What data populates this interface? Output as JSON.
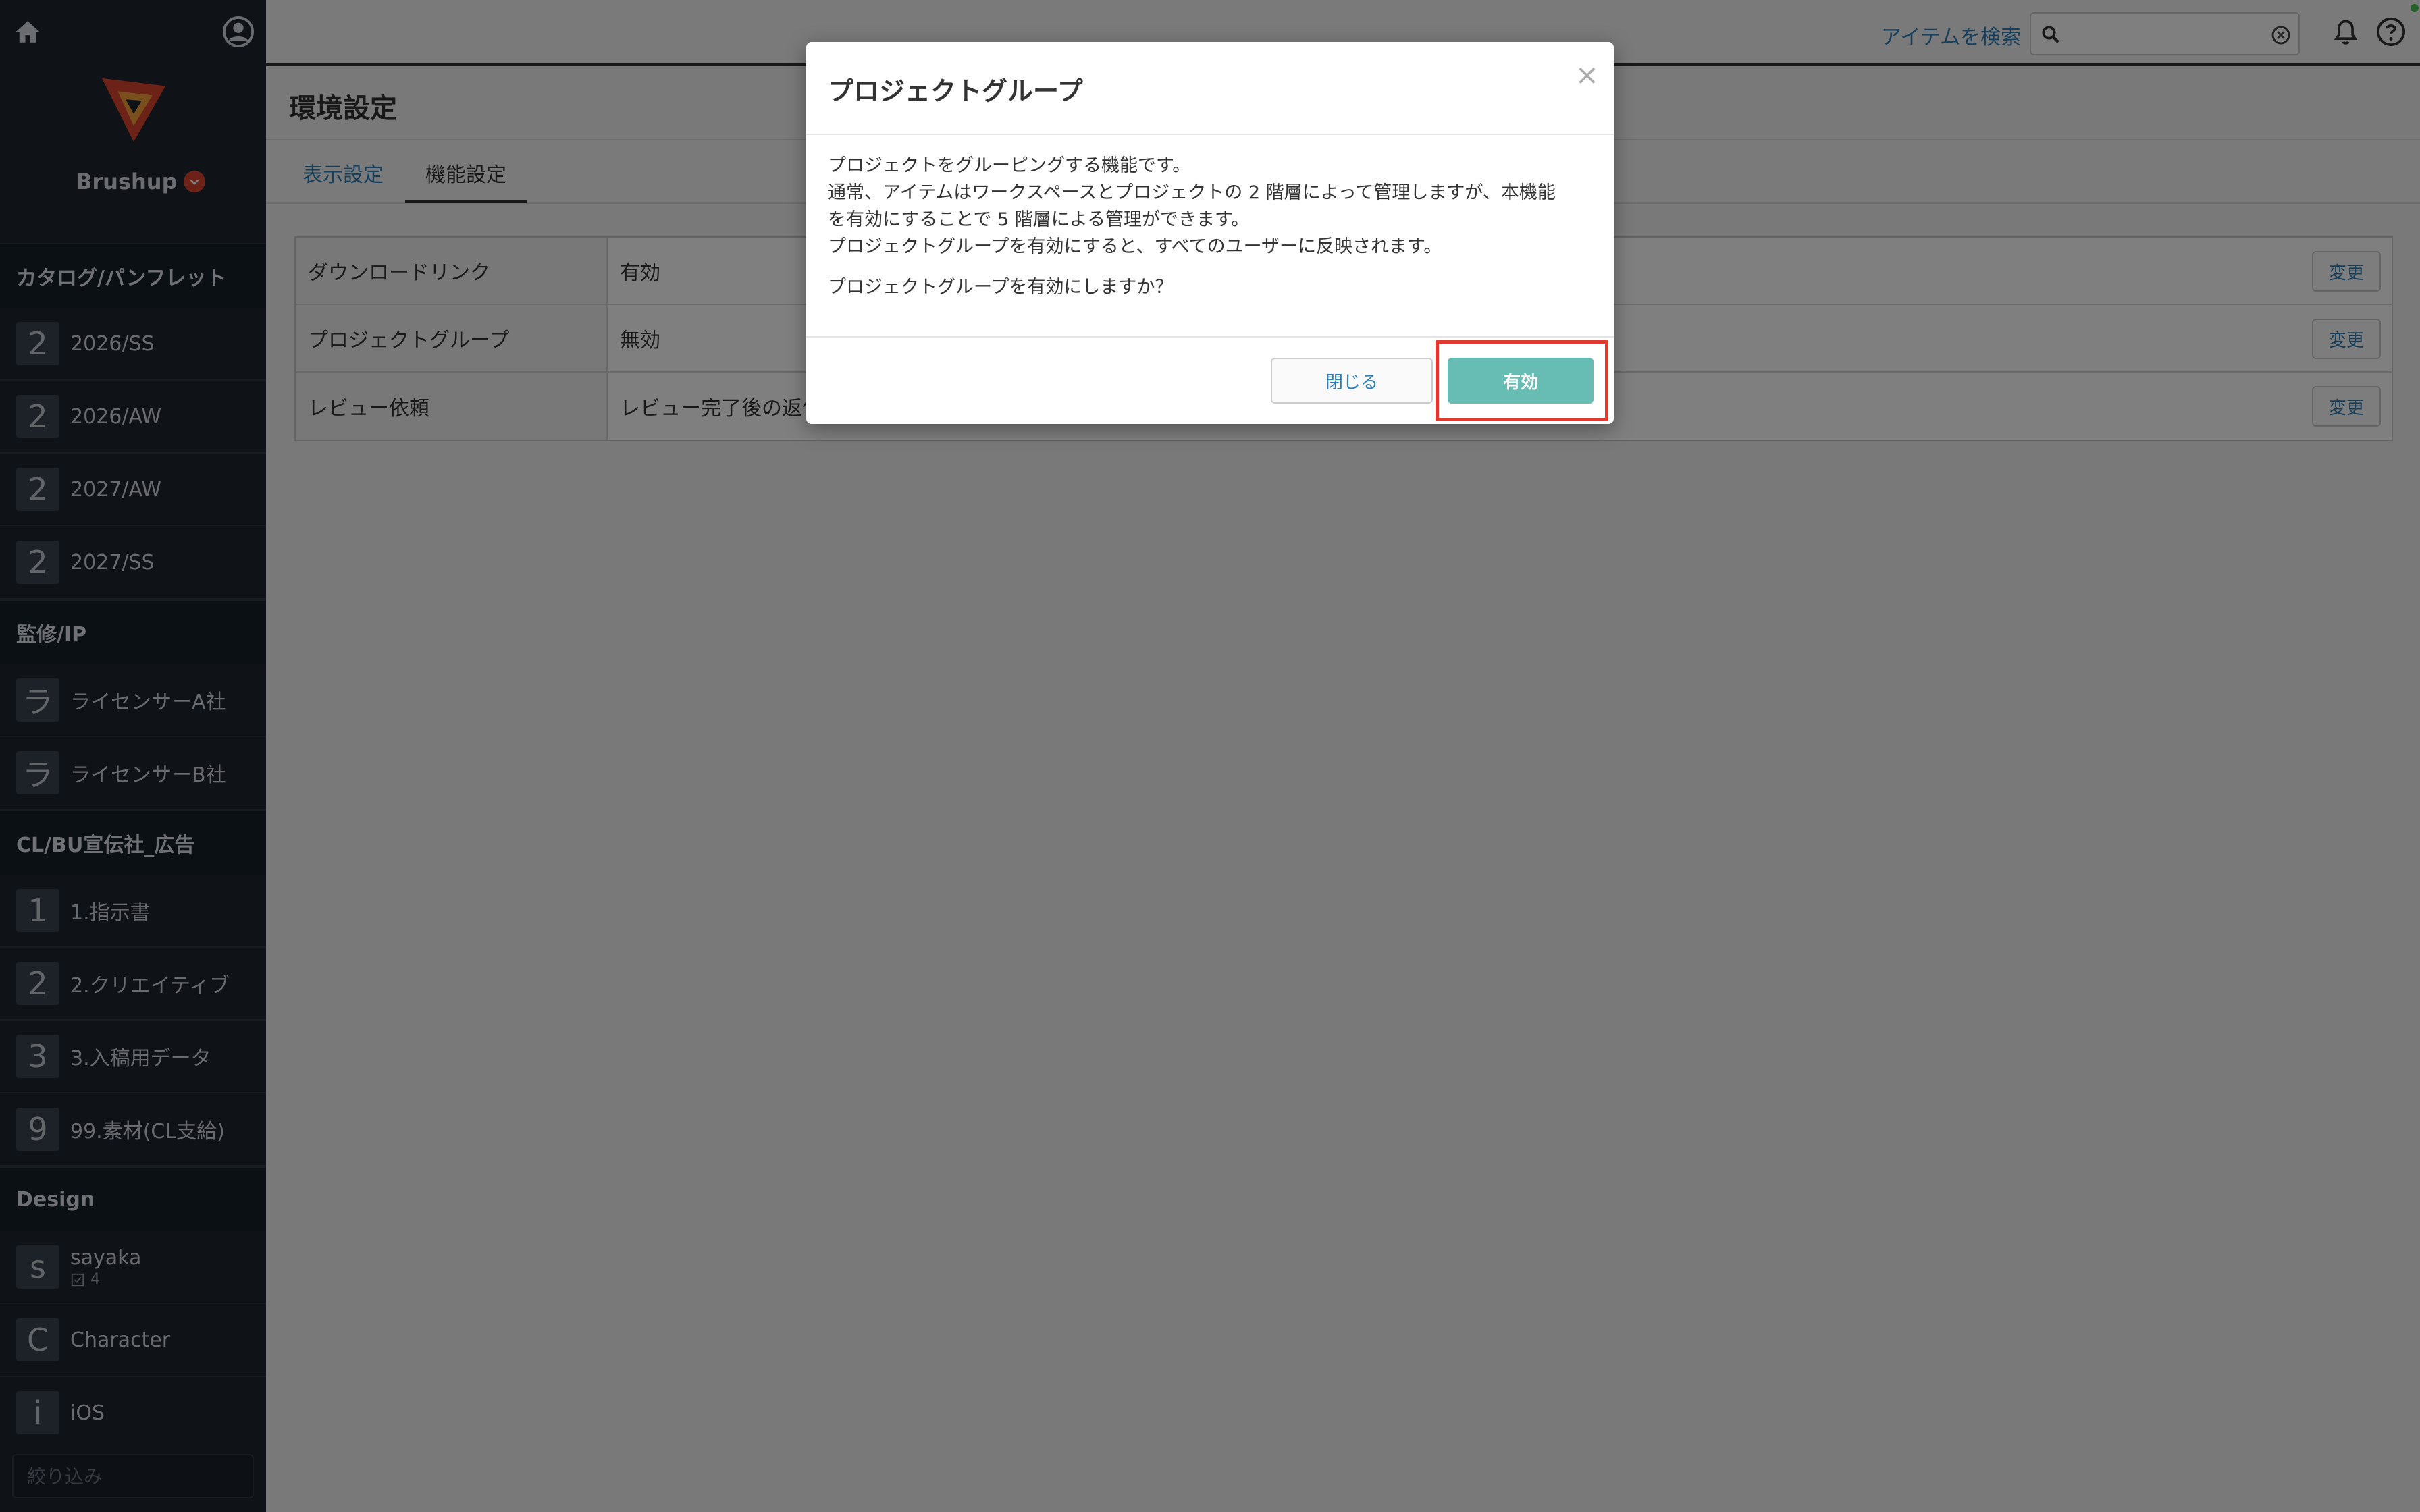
{
  "sidebar": {
    "brand": "Brushup",
    "sections": [
      {
        "title": "カタログ/パンフレット",
        "items": [
          {
            "badge": "2",
            "label": "2026/SS"
          },
          {
            "badge": "2",
            "label": "2026/AW"
          },
          {
            "badge": "2",
            "label": "2027/AW"
          },
          {
            "badge": "2",
            "label": "2027/SS"
          }
        ]
      },
      {
        "title": "監修/IP",
        "items": [
          {
            "badge": "ラ",
            "label": "ライセンサーA社"
          },
          {
            "badge": "ラ",
            "label": "ライセンサーB社"
          }
        ]
      },
      {
        "title": "CL/BU宣伝社_広告",
        "items": [
          {
            "badge": "1",
            "label": "1.指示書"
          },
          {
            "badge": "2",
            "label": "2.クリエイティブ"
          },
          {
            "badge": "3",
            "label": "3.入稿用データ"
          },
          {
            "badge": "9",
            "label": "99.素材(CL支給)"
          }
        ]
      },
      {
        "title": "Design",
        "items": [
          {
            "badge": "s",
            "label": "sayaka",
            "sub_count": "4"
          },
          {
            "badge": "C",
            "label": "Character"
          },
          {
            "badge": "i",
            "label": "iOS"
          }
        ]
      }
    ],
    "filter_placeholder": "絞り込み"
  },
  "topbar": {
    "search_link": "アイテムを検索",
    "search_value": ""
  },
  "main": {
    "title": "環境設定",
    "tabs": [
      {
        "label": "表示設定",
        "active": false
      },
      {
        "label": "機能設定",
        "active": true
      }
    ],
    "settings": [
      {
        "name": "ダウンロードリンク",
        "value": "有効",
        "button": "変更"
      },
      {
        "name": "プロジェクトグループ",
        "value": "無効",
        "button": "変更"
      },
      {
        "name": "レビュー依頼",
        "value": "レビュー完了後の返信",
        "button": "変更"
      }
    ]
  },
  "modal": {
    "title": "プロジェクトグループ",
    "close_symbol": "×",
    "lines": [
      "プロジェクトをグルーピングする機能です。",
      "通常、アイテムはワークスペースとプロジェクトの 2 階層によって管理しますが、本機能",
      "を有効にすることで 5 階層による管理ができます。",
      "プロジェクトグループを有効にすると、すべてのユーザーに反映されます。"
    ],
    "question": "プロジェクトグループを有効にしますか？",
    "cancel_label": "閉じる",
    "confirm_label": "有効"
  },
  "colors": {
    "sidebar_bg": "#1e2730",
    "accent_link": "#2d7fb8",
    "confirm_button": "#67bdb4",
    "highlight_box": "#e03a2f",
    "logo": "#d9442e"
  }
}
